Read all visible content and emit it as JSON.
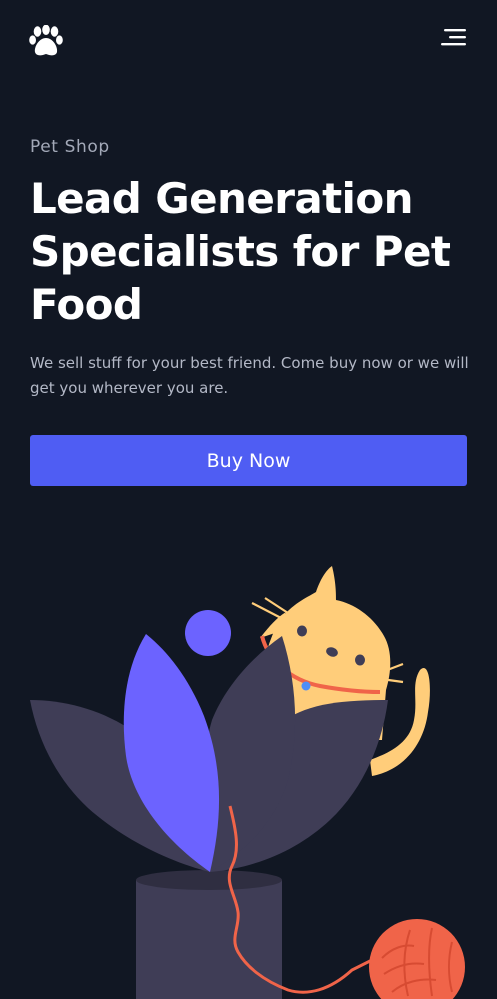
{
  "header": {
    "logo_icon": "paw-icon",
    "menu_icon": "hamburger-menu-icon"
  },
  "hero": {
    "eyebrow": "Pet Shop",
    "headline": "Lead Generation Specialists for Pet Food",
    "description": "We sell stuff for your best friend. Come buy now or we will get you wherever you are.",
    "cta_label": "Buy Now"
  },
  "illustration": {
    "icon": "cat-in-plant-with-yarn-illustration"
  },
  "colors": {
    "background": "#111723",
    "accent": "#4f5df3",
    "leaf_purple": "#6c63ff",
    "leaf_dark": "#3f3d56",
    "cat": "#ffcd7a",
    "yarn": "#f06449"
  }
}
